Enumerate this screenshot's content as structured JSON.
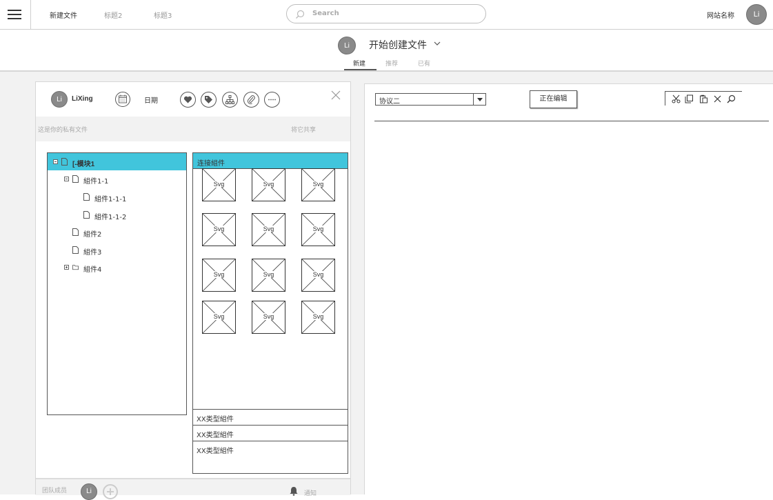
{
  "header": {
    "nav": [
      {
        "label": "新建文件"
      },
      {
        "label": "标题2"
      },
      {
        "label": "标题3"
      }
    ],
    "search_placeholder": "Search",
    "site_name": "网站名称",
    "avatar_initials": "Li"
  },
  "subheader": {
    "avatar_initials": "Li",
    "title": "开始创建文件",
    "tabs": [
      {
        "label": "新建",
        "active": true
      },
      {
        "label": "推荐",
        "active": false
      },
      {
        "label": "已有",
        "active": false
      }
    ]
  },
  "left_panel": {
    "user": {
      "initials": "Li",
      "name": "LiXing"
    },
    "date_label": "日期",
    "action_icons": [
      "heart-icon",
      "tag-icon",
      "hierarchy-icon",
      "paperclip-icon",
      "more-icon"
    ],
    "private_text": "这是你的私有文件",
    "share_text": "将它共享",
    "tree": [
      {
        "label": "[-模块1",
        "level": 0,
        "expander": "minus",
        "selected": true
      },
      {
        "label": "組件1-1",
        "level": 1,
        "expander": "minus",
        "selected": false
      },
      {
        "label": "組件1-1-1",
        "level": 2,
        "expander": "none",
        "selected": false
      },
      {
        "label": "組件1-1-2",
        "level": 2,
        "expander": "none",
        "selected": false
      },
      {
        "label": "組件2",
        "level": 1,
        "expander": "none",
        "selected": false
      },
      {
        "label": "組件3",
        "level": 1,
        "expander": "none",
        "selected": false
      },
      {
        "label": "組件4",
        "level": 1,
        "expander": "plus",
        "selected": false
      }
    ],
    "components": {
      "title": "连接組件",
      "placeholder_label": "Svg",
      "grid_rows": 4,
      "grid_cols": 3,
      "types": [
        {
          "label": "XX类型組件"
        },
        {
          "label": "XX类型組件"
        },
        {
          "label": "XX类型組件"
        }
      ]
    },
    "footer": {
      "team_label": "团队成员",
      "member_initials": "Li",
      "notify_label": "通知"
    }
  },
  "right_panel": {
    "protocol_value": "协议二",
    "edit_button": "正在编辑",
    "toolbar_icons": [
      "cut-icon",
      "copy-icon",
      "paste-icon",
      "delete-icon",
      "search-icon"
    ]
  },
  "colors": {
    "accent": "#41c5dc",
    "avatar": "#8a8a8a",
    "border": "#555555",
    "muted_text": "#aaaaaa"
  }
}
